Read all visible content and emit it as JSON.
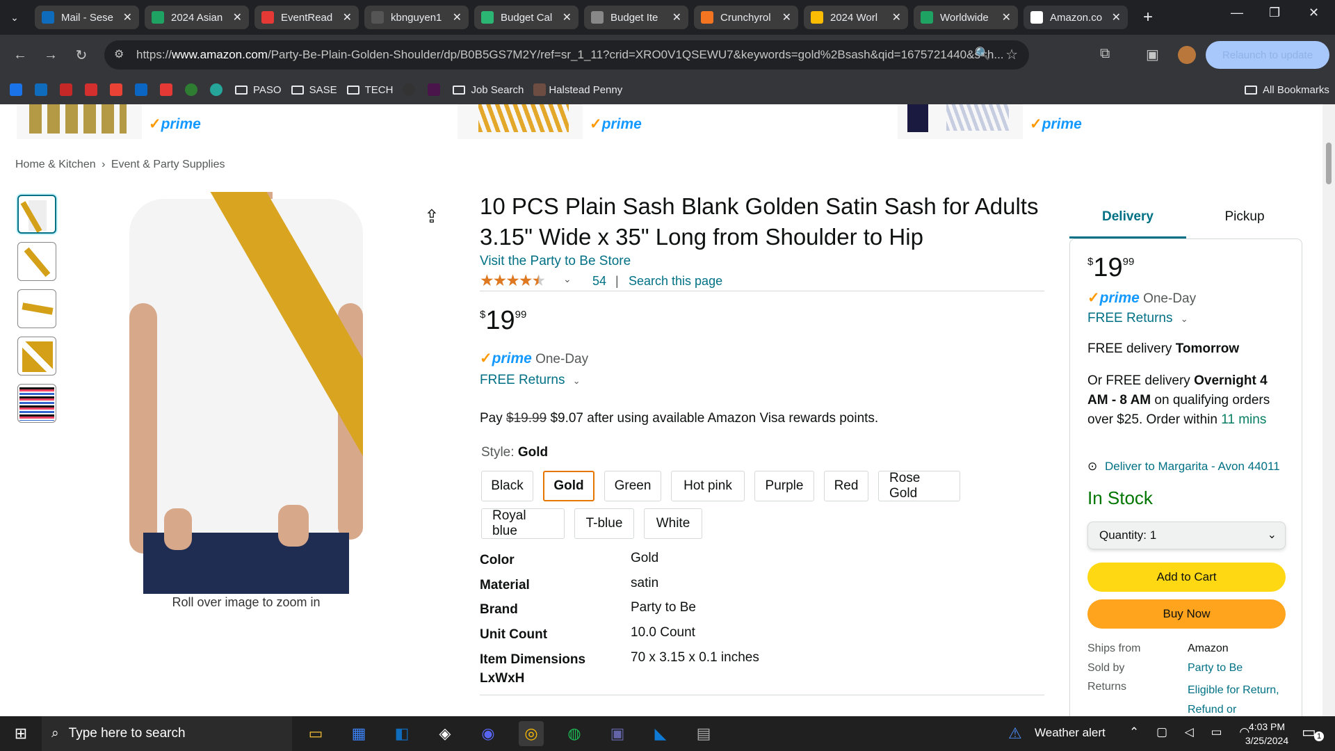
{
  "tabs": [
    {
      "label": "Mail - Sese",
      "icon": "outlook-icon",
      "color": "#0f6cbd"
    },
    {
      "label": "2024 Asian",
      "icon": "sheets-icon",
      "color": "#1ea362"
    },
    {
      "label": "EventRead",
      "icon": "eventread-icon",
      "color": "#e53935"
    },
    {
      "label": "kbnguyen1",
      "icon": "github-icon",
      "color": "#555"
    },
    {
      "label": "Budget Cal",
      "icon": "budget-icon",
      "color": "#2bb673"
    },
    {
      "label": "Budget Ite",
      "icon": "globe-icon",
      "color": "#888"
    },
    {
      "label": "Crunchyrol",
      "icon": "crunchyroll-icon",
      "color": "#f47521"
    },
    {
      "label": "2024 Worl",
      "icon": "drive-icon",
      "color": "#fbbc04"
    },
    {
      "label": "Worldwide",
      "icon": "sheets-icon",
      "color": "#1ea362"
    },
    {
      "label": "Amazon.co",
      "icon": "amazon-icon",
      "color": "#fff"
    }
  ],
  "url": {
    "domain": "www.amazon.com",
    "path": "/Party-Be-Plain-Golden-Shoulder/dp/B0B5GS7M2Y/ref=sr_1_11?crid=XRO0V1QSEWU7&keywords=gold%2Bsash&qid=1675721440&s=h..."
  },
  "url_prefix": "https://",
  "relaunch_label": "Relaunch to update",
  "bookmarks": {
    "paso": "PASO",
    "sase": "SASE",
    "tech": "TECH",
    "job": "Job Search",
    "halstead": "Halstead Penny",
    "all": "All Bookmarks"
  },
  "strip": {
    "prime": "prime"
  },
  "breadcrumb": {
    "a": "Home & Kitchen",
    "sep": "›",
    "b": "Event & Party Supplies"
  },
  "zoom_hint": "Roll over image to zoom in",
  "product": {
    "title": "10 PCS Plain Sash Blank Golden Satin Sash for Adults 3.15\" Wide x 35\" Long from Shoulder to Hip",
    "store_link": "Visit the Party to Be Store",
    "rating_count": "54",
    "search_page": "Search this page",
    "price_sym": "$",
    "price_whole": "19",
    "price_frac": "99",
    "prime_delivery": "One-Day",
    "free_returns": "FREE Returns",
    "pay_text_a": "Pay",
    "pay_strike": "$19.99",
    "pay_text_b": "$9.07 after using available Amazon Visa rewards points.",
    "style_label": "Style:",
    "style_value": "Gold",
    "styles": [
      "Black",
      "Gold",
      "Green",
      "Hot pink",
      "Purple",
      "Red",
      "Rose Gold",
      "Royal blue",
      "T-blue",
      "White"
    ],
    "specs": [
      {
        "k": "Color",
        "v": "Gold"
      },
      {
        "k": "Material",
        "v": "satin"
      },
      {
        "k": "Brand",
        "v": "Party to Be"
      },
      {
        "k": "Unit Count",
        "v": "10.0 Count"
      },
      {
        "k": "Item Dimensions LxWxH",
        "v": "70 x 3.15 x 0.1 inches"
      }
    ]
  },
  "buybox": {
    "tab_delivery": "Delivery",
    "tab_pickup": "Pickup",
    "price_sym": "$",
    "price_whole": "19",
    "price_frac": "99",
    "prime_delivery": "One-Day",
    "free_returns": "FREE Returns",
    "free_delivery_a": "FREE delivery",
    "free_delivery_b": "Tomorrow",
    "or_free_a": "Or FREE delivery",
    "or_free_b": "Overnight",
    "or_free_c": "4 AM - 8 AM",
    "or_free_d": "on qualifying orders over $25. Order within",
    "countdown": "11 mins",
    "deliver_to": "Deliver to Margarita - Avon 44011",
    "stock": "In Stock",
    "quantity": "Quantity:  1",
    "add_to_cart": "Add to Cart",
    "buy_now": "Buy Now",
    "ships_from_k": "Ships from",
    "ships_from_v": "Amazon",
    "sold_by_k": "Sold by",
    "sold_by_v": "Party to Be",
    "returns_k": "Returns",
    "returns_v": "Eligible for Return, Refund or"
  },
  "taskbar": {
    "search": "Type here to search",
    "weather": "Weather alert",
    "time": "4:03 PM",
    "date": "3/25/2024",
    "notif": "1"
  }
}
